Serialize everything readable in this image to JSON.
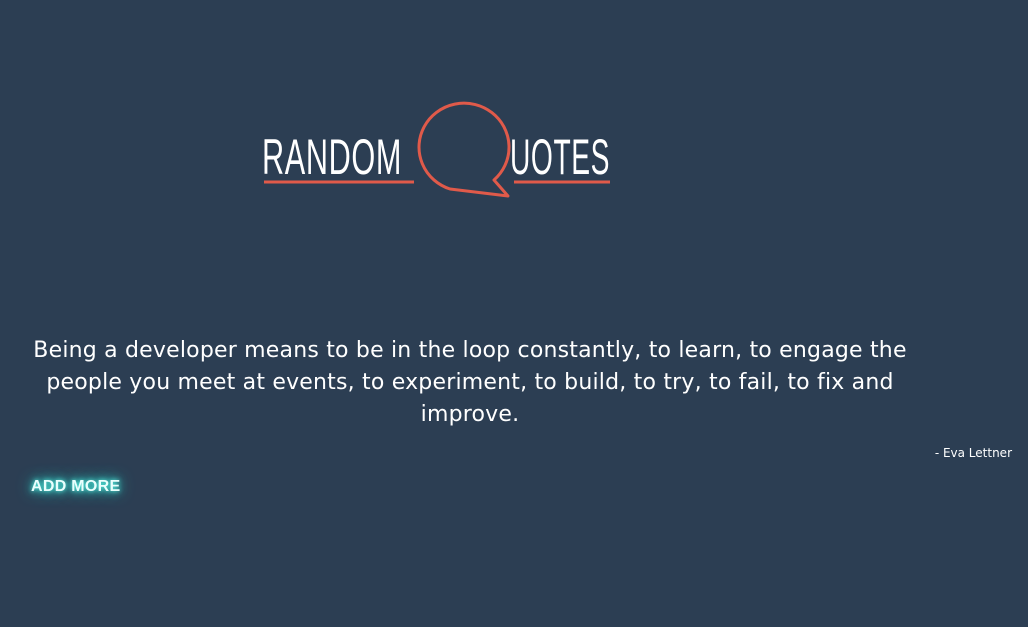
{
  "header": {
    "logo": {
      "word_left": "RANDOM",
      "word_right": "UOTES",
      "icon": "speech-bubble-q-icon",
      "accent_color": "#e05a4a"
    }
  },
  "quote": {
    "text": "Being a developer means to be in the loop constantly, to learn, to engage the people you meet at events, to experiment, to build, to try, to fail, to fix and improve.",
    "author": "- Eva Lettner"
  },
  "actions": {
    "add_more_label": "ADD MORE",
    "glow_color": "#2fe0d2"
  },
  "theme": {
    "background": "#2c3e53",
    "text_color": "#ffffff"
  }
}
